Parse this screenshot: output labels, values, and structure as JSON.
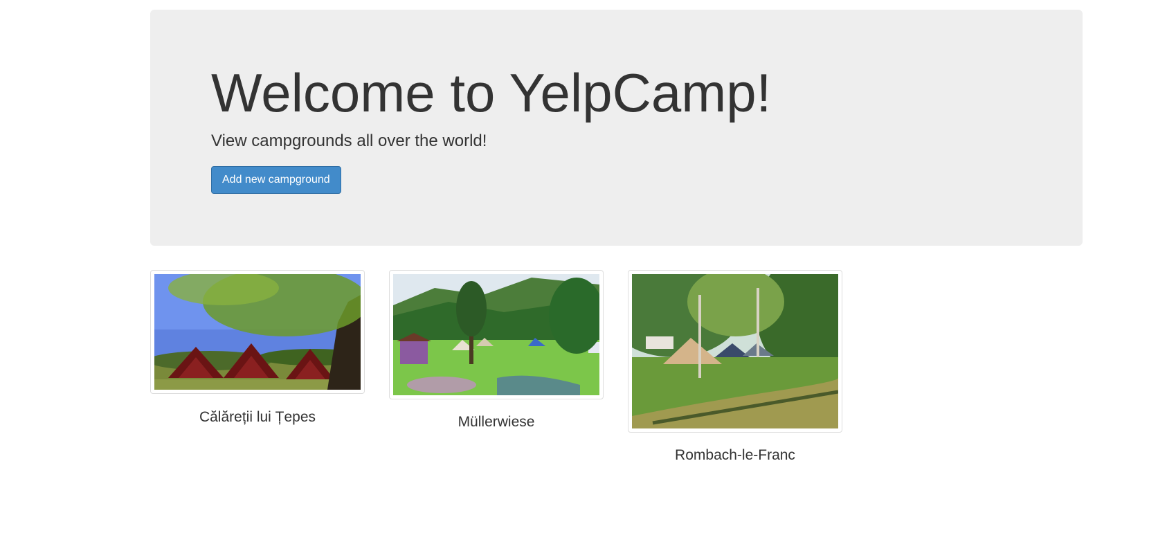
{
  "jumbotron": {
    "title": "Welcome to YelpCamp!",
    "lead": "View campgrounds all over the world!",
    "add_button_label": "Add new campground"
  },
  "campgrounds": [
    {
      "name": "Călăreții lui Țepes",
      "image": "photo of wooden A-frame cabins under a tree"
    },
    {
      "name": "Müllerwiese",
      "image": "photo of a meadow campsite with tents and forested hills"
    },
    {
      "name": "Rombach-le-Franc",
      "image": "photo of tents on grass beside a stream and birch trees"
    }
  ],
  "colors": {
    "jumbotron_bg": "#eeeeee",
    "button_bg": "#428bca",
    "button_border": "#2e6da4",
    "text": "#333333"
  }
}
